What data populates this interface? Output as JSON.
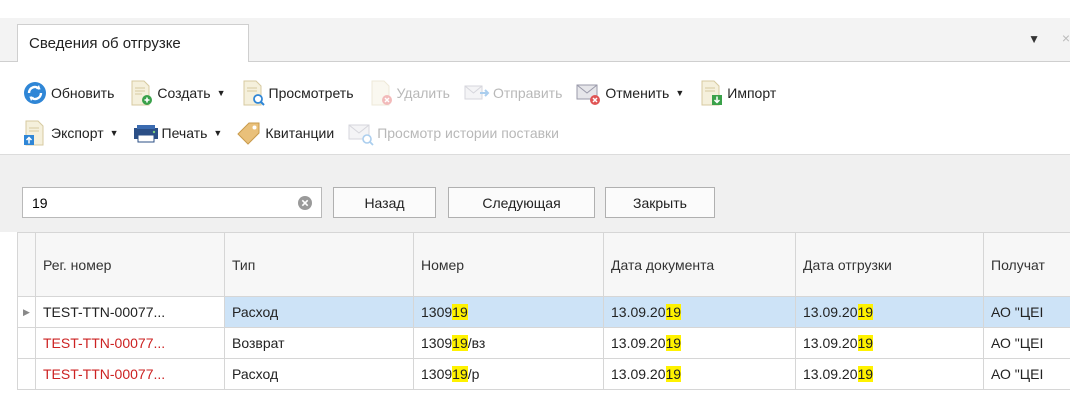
{
  "tab": {
    "title": "Сведения об отгрузке",
    "menu_icon": "▼",
    "close_icon": "×"
  },
  "toolbar": {
    "row1": [
      {
        "label": "Обновить",
        "icon": "refresh-icon",
        "enabled": true,
        "dropdown": false
      },
      {
        "label": "Создать",
        "icon": "create-doc-icon",
        "enabled": true,
        "dropdown": true
      },
      {
        "label": "Просмотреть",
        "icon": "view-doc-icon",
        "enabled": true,
        "dropdown": false
      },
      {
        "label": "Удалить",
        "icon": "delete-doc-icon",
        "enabled": false,
        "dropdown": false
      },
      {
        "label": "Отправить",
        "icon": "send-mail-icon",
        "enabled": false,
        "dropdown": false
      },
      {
        "label": "Отменить",
        "icon": "cancel-mail-icon",
        "enabled": true,
        "dropdown": true
      },
      {
        "label": "Импорт",
        "icon": "import-doc-icon",
        "enabled": true,
        "dropdown": false
      }
    ],
    "row2": [
      {
        "label": "Экспорт",
        "icon": "export-doc-icon",
        "enabled": true,
        "dropdown": true
      },
      {
        "label": "Печать",
        "icon": "printer-icon",
        "enabled": true,
        "dropdown": true
      },
      {
        "label": "Квитанции",
        "icon": "tag-icon",
        "enabled": true,
        "dropdown": false
      },
      {
        "label": "Просмотр истории поставки",
        "icon": "history-mail-icon",
        "enabled": false,
        "dropdown": false
      }
    ]
  },
  "search": {
    "value": "19",
    "back_label": "Назад",
    "next_label": "Следующая",
    "close_label": "Закрыть"
  },
  "table": {
    "columns": [
      "Рег. номер",
      "Тип",
      "Номер",
      "Дата документа",
      "Дата отгрузки",
      "Получат"
    ],
    "rows": [
      {
        "reg": "TEST-TTN-00077...",
        "reg_red": false,
        "type": "Расход",
        "number": [
          "1309",
          "19",
          ""
        ],
        "doc_date": [
          "13.09.20",
          "19"
        ],
        "ship_date": [
          "13.09.20",
          "19"
        ],
        "recipient": "АО \"ЦЕI",
        "selected": true
      },
      {
        "reg": "TEST-TTN-00077...",
        "reg_red": true,
        "type": "Возврат",
        "number": [
          "1309",
          "19",
          "/вз"
        ],
        "doc_date": [
          "13.09.20",
          "19"
        ],
        "ship_date": [
          "13.09.20",
          "19"
        ],
        "recipient": "АО \"ЦЕI",
        "selected": false
      },
      {
        "reg": "TEST-TTN-00077...",
        "reg_red": true,
        "type": "Расход",
        "number": [
          "1309",
          "19",
          "/р"
        ],
        "doc_date": [
          "13.09.20",
          "19"
        ],
        "ship_date": [
          "13.09.20",
          "19"
        ],
        "recipient": "АО \"ЦЕI",
        "selected": false
      }
    ],
    "row_indicator": "▶"
  },
  "colors": {
    "selected_row": "#cde3f7",
    "highlight": "#fff200",
    "error_text": "#cc2222",
    "disabled_text": "#b8b8b8"
  }
}
